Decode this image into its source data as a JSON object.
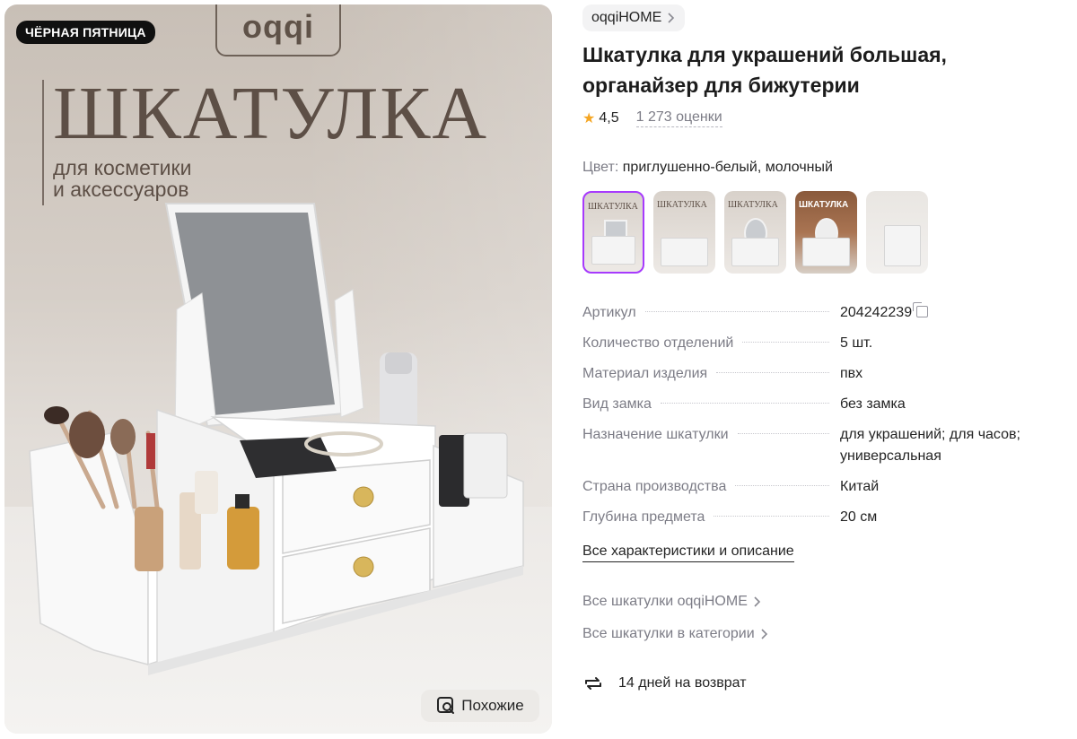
{
  "hero": {
    "badge": "ЧЁРНАЯ ПЯТНИЦА",
    "brand": "oqqi",
    "title": "ШКАТУЛКА",
    "subtitle": "для косметики\nи аксессуаров",
    "similar_label": "Похожие"
  },
  "seller": "oqqiHOME",
  "product": {
    "title": "Шкатулка для украшений большая, органайзер для бижутерии",
    "rating": "4,5",
    "ratings_count": "1 273 оценки",
    "color_label": "Цвет:",
    "color_value": "приглушенно-белый, молочный",
    "thumbnails": [
      {
        "caption": "ШКАТУЛКА"
      },
      {
        "caption": "ШКАТУЛКА"
      },
      {
        "caption": "ШКАТУЛКА"
      },
      {
        "caption": "ШКАТУЛКА"
      },
      {
        "caption": ""
      }
    ]
  },
  "specs": [
    {
      "key": "Артикул",
      "value": "204242239"
    },
    {
      "key": "Количество отделений",
      "value": "5 шт."
    },
    {
      "key": "Материал изделия",
      "value": "пвх"
    },
    {
      "key": "Вид замка",
      "value": "без замка"
    },
    {
      "key": "Назначение шкатулки",
      "value": "для украшений; для часов; универсальная"
    },
    {
      "key": "Страна производства",
      "value": "Китай"
    },
    {
      "key": "Глубина предмета",
      "value": "20 см"
    }
  ],
  "links": {
    "all_specs": "Все характеристики и описание",
    "all_seller": "Все шкатулки oqqiHOME",
    "all_category": "Все шкатулки в категории"
  },
  "return_policy": "14 дней на возврат",
  "colors": {
    "accent": "#a73afd",
    "star": "#f5a623",
    "muted": "#7c7c86"
  }
}
